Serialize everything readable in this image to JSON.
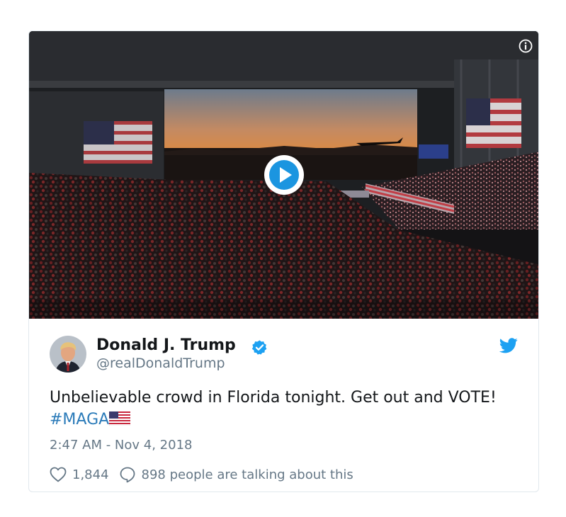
{
  "author": {
    "name": "Donald J. Trump",
    "handle": "@realDonaldTrump"
  },
  "tweet": {
    "text": "Unbelievable crowd in Florida tonight. Get out and VOTE! ",
    "hashtag": "#MAGA",
    "timestamp": "2:47 AM - Nov 4, 2018"
  },
  "actions": {
    "likes": "1,844",
    "talking": "898 people are talking about this"
  },
  "icons": {
    "info": "info-icon",
    "play": "play-icon",
    "verified": "verified-badge-icon",
    "twitter": "twitter-bird-icon",
    "like": "heart-icon",
    "reply": "reply-bubble-icon",
    "flag": "us-flag-emoji"
  },
  "colors": {
    "link": "#2b7bb9",
    "verified": "#1da1f2",
    "secondary_text": "#657786",
    "primary_text": "#14171a"
  }
}
